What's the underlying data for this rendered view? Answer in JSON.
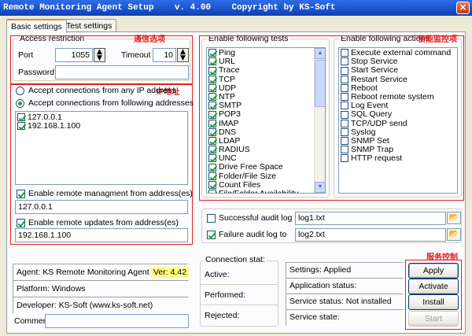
{
  "window": {
    "title": "Remote Monitoring Agent Setup    v. 4.00    Copyright by KS-Soft",
    "close_glyph": "×"
  },
  "tabs": [
    {
      "label": "Basic settings"
    },
    {
      "label": "Test settings"
    }
  ],
  "access": {
    "title": "Access restriction",
    "port_label": "Port",
    "port_value": "1055",
    "timeout_label": "Timeout",
    "timeout_value": "10",
    "password_label": "Password",
    "password_value": ""
  },
  "connections": {
    "any_ip_label": "Accept connections from any IP address",
    "following_label": "Accept connections from following addresses",
    "addresses": [
      "127.0.0.1",
      "192.168.1.100"
    ],
    "mgmt_label": "Enable remote managment from address(es)",
    "mgmt_value": "127.0.0.1",
    "updates_label": "Enable remote updates from address(es)",
    "updates_value": "192.168.1.100"
  },
  "tests": {
    "title": "Enable following tests",
    "items": [
      "Ping",
      "URL",
      "Trace",
      "TCP",
      "UDP",
      "NTP",
      "SMTP",
      "POP3",
      "IMAP",
      "DNS",
      "LDAP",
      "RADIUS",
      "UNC",
      "Drive Free Space",
      "Folder/File Size",
      "Count Files",
      "File/Folder Availability"
    ]
  },
  "actions": {
    "title": "Enable following actions",
    "items": [
      "Execute external command",
      "Stop Service",
      "Start Service",
      "Restart Service",
      "Reboot",
      "Reboot remote system",
      "Log Event",
      "SQL Query",
      "TCP/UDP send",
      "Syslog",
      "SNMP Set",
      "SNMP Trap",
      "HTTP request"
    ]
  },
  "audit": {
    "success_label": "Successful audit log to",
    "success_file": "log1.txt",
    "failure_label": "Failure audit log to",
    "failure_file": "log2.txt"
  },
  "info": {
    "agent": "Agent: KS Remote Monitoring Agent",
    "version": "Ver: 4.42",
    "platform": "Platform: Windows",
    "developer": "Developer: KS-Soft (www.ks-soft.net)",
    "comment_label": "Comment",
    "comment_value": ""
  },
  "connection_stat": {
    "title": "Connection stat:",
    "active": "Active:",
    "performed": "Performed:",
    "rejected": "Rejected:"
  },
  "service": {
    "settings": "Settings: Applied",
    "app_status": "Application status:",
    "service_status": "Service status: Not installed",
    "service_state": "Service state:"
  },
  "buttons": {
    "apply": "Apply",
    "activate": "Activate",
    "install": "Install",
    "start": "Start"
  },
  "annotations": {
    "comm": "通信选项",
    "ip": "IP地址",
    "monitor": "使能监控项",
    "service": "服务控制"
  },
  "colors": {
    "titlebar": "#1a52c9",
    "annotation": "#e02020",
    "version_bg": "#ffff80"
  }
}
